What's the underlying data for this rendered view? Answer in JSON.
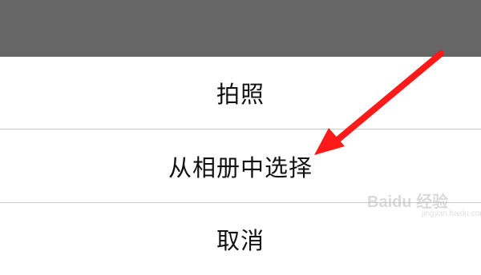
{
  "action_sheet": {
    "options": [
      {
        "label": "拍照"
      },
      {
        "label": "从相册中选择"
      },
      {
        "label": "取消"
      }
    ]
  },
  "annotation": {
    "arrow_color": "#ff1a1a",
    "points_to": "从相册中选择"
  },
  "watermark": {
    "brand": "Baidu 经验",
    "domain": "jingyan.baidu.com"
  },
  "colors": {
    "overlay": "#666666",
    "sheet_bg": "#ffffff",
    "divider": "#c9c9c9",
    "text": "#111111"
  }
}
